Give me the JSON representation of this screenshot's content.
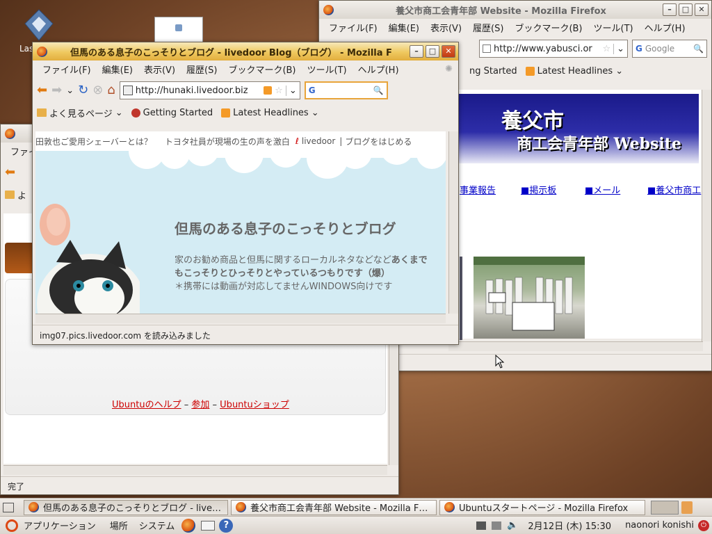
{
  "desktop": {
    "icons": [
      {
        "label": "Las",
        "name": "laserwm-icon"
      },
      {
        "label": "",
        "name": "document-thumb-icon"
      }
    ]
  },
  "win_yabu": {
    "title": "養父市商工会青年部 Website - Mozilla Firefox",
    "menu": [
      "ファイル(F)",
      "編集(E)",
      "表示(V)",
      "履歴(S)",
      "ブックマーク(B)",
      "ツール(T)",
      "ヘルプ(H)"
    ],
    "url": "http://www.yabusci.or",
    "search_placeholder": "Google",
    "bookmarks": [
      "ng Started",
      "Latest Headlines"
    ],
    "banner_line1": "養父市",
    "banner_line2": "商工会青年部 Website",
    "links": [
      "事業報告",
      "■掲示板",
      "■メール",
      "■養父市商工"
    ]
  },
  "win_ubuntu": {
    "title_fragment": "ファイ",
    "bookmark_fragment": "よ",
    "links": [
      "Ubuntuのヘルプ",
      "参加",
      "Ubuntuショップ"
    ],
    "sep": "–",
    "status": "完了"
  },
  "win_blog": {
    "title": "但馬のある息子のこっそりとブログ - livedoor Blog（ブログ） - Mozilla F",
    "menu": [
      "ファイル(F)",
      "編集(E)",
      "表示(V)",
      "履歴(S)",
      "ブックマーク(B)",
      "ツール(T)",
      "ヘルプ(H)"
    ],
    "url": "http://hunaki.livedoor.biz",
    "bookmarks": [
      "よく見るページ",
      "Getting Started",
      "Latest Headlines"
    ],
    "ticker": [
      "田敦也ご愛用シェーバーとは？",
      "トヨタ社員が現場の生の声を激白"
    ],
    "livedoor": "livedoor",
    "start_blog": "ブログをはじめる",
    "blog_title": "但馬のある息子のこっそりとブログ",
    "desc_line1_a": "家のお勧め商品と但馬に関するローカルネタなどなど",
    "desc_line1_b": "あくまで",
    "desc_line2": "もこっそりとひっそりとやっているつもりです（爆）",
    "desc_line3": "＊携帯には動画が対応してませんWINDOWS向けです",
    "status": "img07.pics.livedoor.com を読み込みました"
  },
  "taskbar": {
    "tasks": [
      "但馬のある息子のこっそりとブログ - live…",
      "養父市商工会青年部 Website - Mozilla F…",
      "Ubuntuスタートページ - Mozilla Firefox"
    ]
  },
  "panel": {
    "applications": "アプリケーション",
    "places": "場所",
    "system": "システム",
    "clock": "2月12日 (木) 15:30",
    "user": "naonori konishi"
  },
  "colors": {
    "accent_title": "#efc85e",
    "banner": "#1c1c8c",
    "link": "#0000c8"
  }
}
